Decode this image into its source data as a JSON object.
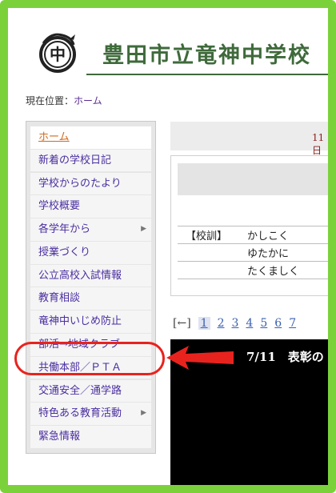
{
  "header": {
    "school_name": "豊田市立竜神中学校",
    "logo_glyph": "中"
  },
  "breadcrumb": {
    "label": "現在位置：",
    "home": "ホーム"
  },
  "sidebar": {
    "items": [
      {
        "label": "ホーム",
        "active": true,
        "submenu": false
      },
      {
        "label": "新着の学校日記",
        "submenu": false
      },
      {
        "label": "学校からのたより",
        "submenu": false
      },
      {
        "label": "学校概要",
        "submenu": false
      },
      {
        "label": "各学年から",
        "submenu": true
      },
      {
        "label": "授業づくり",
        "submenu": false
      },
      {
        "label": "公立高校入試情報",
        "submenu": false
      },
      {
        "label": "教育相談",
        "submenu": false
      },
      {
        "label": "竜神中いじめ防止",
        "submenu": false
      },
      {
        "label": "部活→地域クラブ",
        "submenu": false,
        "highlighted": true
      },
      {
        "label": "共働本部／ＰＴＡ",
        "submenu": false
      },
      {
        "label": "交通安全／通学路",
        "submenu": false
      },
      {
        "label": "特色ある教育活動",
        "submenu": true
      },
      {
        "label": "緊急情報",
        "submenu": false
      }
    ]
  },
  "main": {
    "top_strip_text": "11日",
    "motto": {
      "key": "【校訓】",
      "values": [
        "かしこく",
        "ゆたかに",
        "たくましく"
      ]
    },
    "pager": {
      "prev": "[←]",
      "pages": [
        "1",
        "2",
        "3",
        "4",
        "5",
        "6",
        "7"
      ],
      "current": "1"
    },
    "news_headline": "7/11　表彰の"
  },
  "colors": {
    "frame": "#7bd13a",
    "highlight": "#e8231e",
    "title": "#3f6a3b",
    "menu_link": "#4a2ea0"
  }
}
